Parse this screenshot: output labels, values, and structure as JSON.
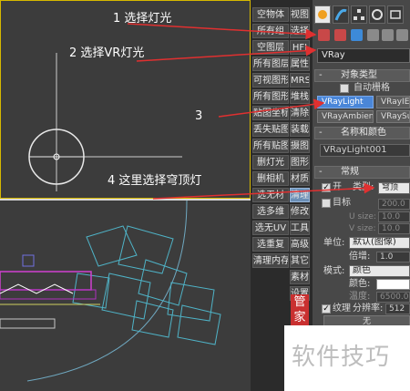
{
  "annotations": {
    "step1": "1 选择灯光",
    "step2": "2 选择VR灯光",
    "step3": "3",
    "step4": "4 这里选择穹顶灯"
  },
  "left_buttons": [
    "空物体",
    "所有组",
    "空图层",
    "所有图层",
    "可视图形",
    "所有图形",
    "贴图坐标",
    "丢失贴图",
    "所有贴图",
    "删灯光",
    "删相机",
    "选无材",
    "选多维",
    "选无UV",
    "选重复",
    "清理内存"
  ],
  "right_buttons": [
    "视图",
    "选择",
    "HFI",
    "属性",
    "MRS",
    "堆栈",
    "清除",
    "装载",
    "摄图",
    "图形",
    "材质",
    "清理",
    "修改",
    "工具",
    "高级",
    "其它",
    "素材",
    "设置"
  ],
  "guan_label": "管家",
  "command_panel": {
    "category_value": "VRay",
    "object_type": {
      "title": "对象类型",
      "autogrid_label": "自动栅格",
      "buttons": [
        "VRayLight",
        "VRayIES",
        "VRayAmbientLight",
        "VRaySun"
      ],
      "selected": "VRayLight"
    },
    "name_color": {
      "title": "名称和颜色",
      "name_value": "VRayLight001"
    },
    "general": {
      "title": "常规",
      "on_label": "开",
      "type_label": "类型:",
      "type_value": "穹顶",
      "target_label": "目标",
      "target_value": "200.0",
      "usize_label": "U size:",
      "usize_value": "10.0",
      "vsize_label": "V size:",
      "vsize_value": "10.0",
      "units_label": "单位:",
      "units_value": "默认(图像)",
      "mult_label": "倍增:",
      "mult_value": "1.0",
      "mode_label": "模式:",
      "mode_value": "颜色",
      "color_label": "颜色:",
      "temp_label": "温度:",
      "temp_value": "6500.0",
      "texture_label": "纹理",
      "res_label": "分辨率:",
      "res_value": "512",
      "none_label": "无"
    }
  },
  "watermark": "软件技巧",
  "colors": {
    "accent_blue": "#4a86d8",
    "annotation_red": "#e03030",
    "viewport_border": "#d6b800",
    "guan_red": "#c93030"
  }
}
